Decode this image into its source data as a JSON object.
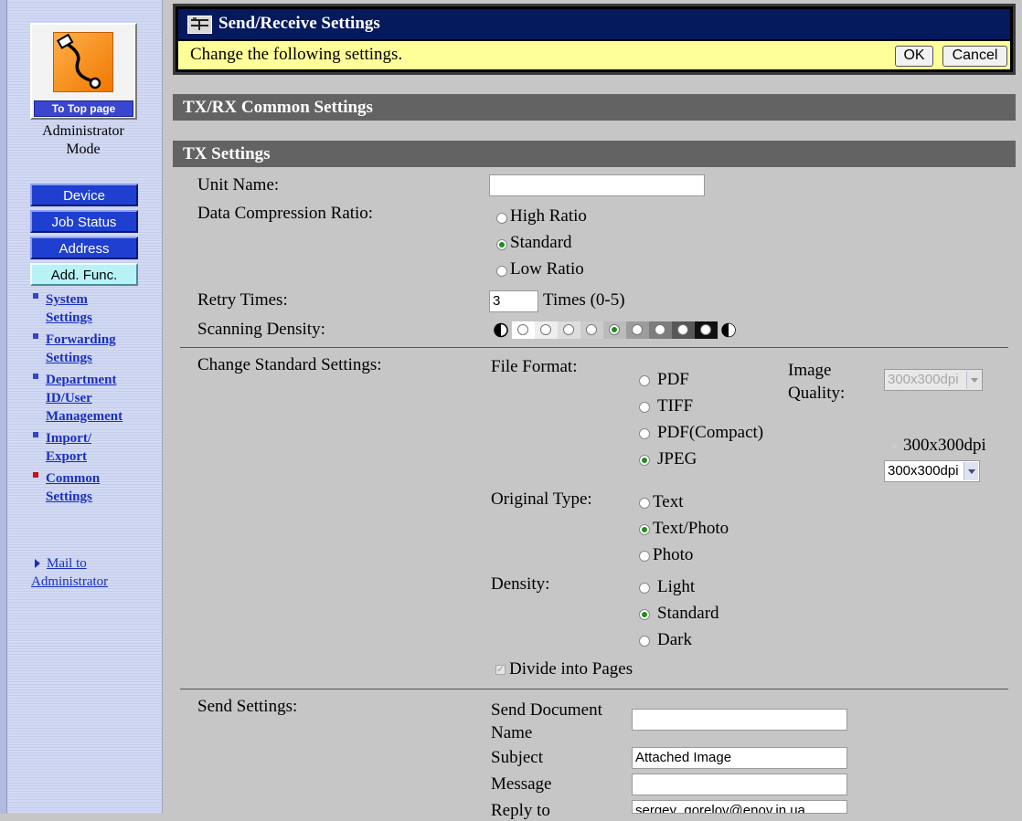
{
  "sidebar": {
    "top_page_label": "To Top page",
    "mode_line1": "Administrator",
    "mode_line2": "Mode",
    "nav_buttons": [
      "Device",
      "Job Status",
      "Address",
      "Add. Func."
    ],
    "links": [
      {
        "line1": "System",
        "line2": "Settings",
        "line3": ""
      },
      {
        "line1": "Forwarding",
        "line2": "Settings",
        "line3": ""
      },
      {
        "line1": "Department",
        "line2": "ID/User",
        "line3": "Management"
      },
      {
        "line1": "Import/",
        "line2": "Export",
        "line3": ""
      },
      {
        "line1": "Common",
        "line2": "Settings",
        "line3": ""
      }
    ],
    "mail_line1": "Mail to",
    "mail_line2": "Administrator"
  },
  "header": {
    "title": "Send/Receive Settings",
    "message": "Change the following settings.",
    "ok_label": "OK",
    "cancel_label": "Cancel"
  },
  "sections": {
    "common": "TX/RX Common Settings",
    "tx": "TX Settings"
  },
  "tx": {
    "unit_name_label": "Unit Name:",
    "unit_name_value": "",
    "compression_label": "Data Compression Ratio:",
    "compression_options": [
      "High Ratio",
      "Standard",
      "Low Ratio"
    ],
    "retry_label": "Retry Times:",
    "retry_value": "3",
    "retry_suffix": "Times (0-5)",
    "scan_density_label": "Scanning Density:",
    "scan_density_selected": 5
  },
  "standard": {
    "label": "Change Standard Settings:",
    "file_format_label": "File Format:",
    "file_formats": [
      "PDF",
      "TIFF",
      "PDF(Compact)",
      "JPEG"
    ],
    "image_quality_line1": "Image",
    "image_quality_line2": "Quality:",
    "quality_disabled_value": "300x300dpi",
    "jpeg_resolution_text": "300x300dpi",
    "jpeg_resolution_select": "300x300dpi",
    "original_type_label": "Original Type:",
    "original_types": [
      "Text",
      "Text/Photo",
      "Photo"
    ],
    "density_label": "Density:",
    "densities": [
      "Light",
      "Standard",
      "Dark"
    ],
    "divide_pages_label": "Divide into Pages"
  },
  "send": {
    "label": "Send Settings:",
    "doc_name_line1": "Send Document",
    "doc_name_line2": "Name",
    "doc_name_value": "",
    "subject_label": "Subject",
    "subject_value": "Attached Image",
    "message_label": "Message",
    "message_value": "",
    "reply_to_label": "Reply to",
    "reply_to_value": "sergey_gorelov@enov.in.ua"
  }
}
